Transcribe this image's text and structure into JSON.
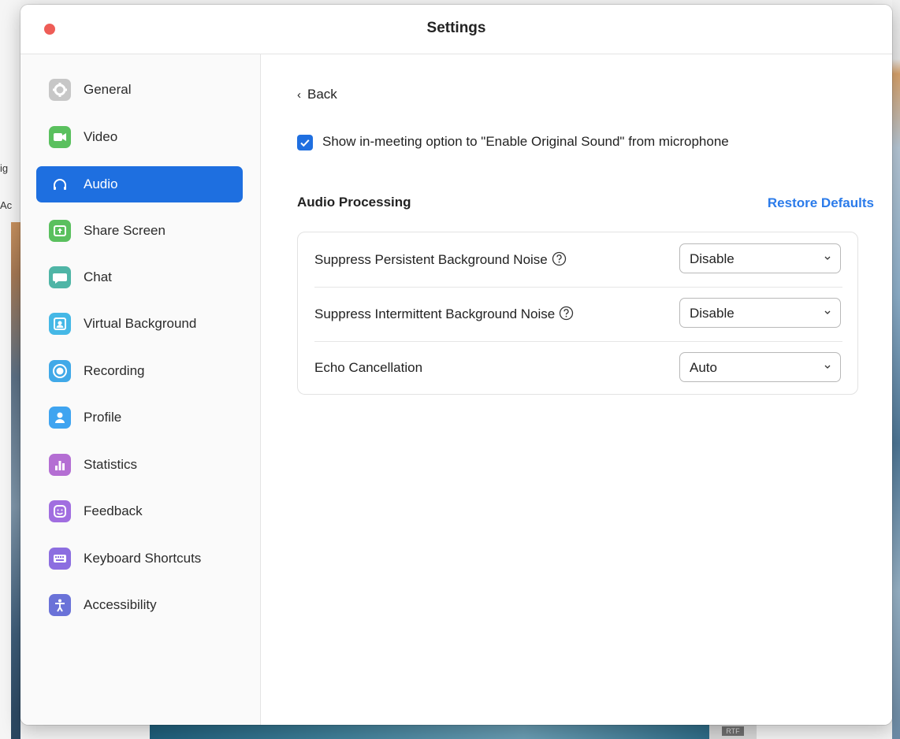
{
  "window": {
    "title": "Settings"
  },
  "background": {
    "frag_left_1": "ig",
    "frag_left_2": "Ac",
    "frag_bottom": "RTF"
  },
  "sidebar": {
    "items": [
      {
        "label": "General",
        "icon": "gear-icon",
        "color": "#c7c7c7"
      },
      {
        "label": "Video",
        "icon": "video-camera-icon",
        "color": "#5ac05e"
      },
      {
        "label": "Audio",
        "icon": "headphones-icon",
        "color": "#1e6fe0",
        "active": true
      },
      {
        "label": "Share Screen",
        "icon": "share-screen-icon",
        "color": "#5ac05e"
      },
      {
        "label": "Chat",
        "icon": "chat-bubble-icon",
        "color": "#4fb5a6"
      },
      {
        "label": "Virtual Background",
        "icon": "person-frame-icon",
        "color": "#45b8e6"
      },
      {
        "label": "Recording",
        "icon": "record-icon",
        "color": "#40a9e8"
      },
      {
        "label": "Profile",
        "icon": "profile-icon",
        "color": "#3fa4f0"
      },
      {
        "label": "Statistics",
        "icon": "bar-chart-icon",
        "color": "#b46ed3"
      },
      {
        "label": "Feedback",
        "icon": "smiley-icon",
        "color": "#a16ee0"
      },
      {
        "label": "Keyboard Shortcuts",
        "icon": "keyboard-icon",
        "color": "#8c6ee0"
      },
      {
        "label": "Accessibility",
        "icon": "accessibility-icon",
        "color": "#6a72d8"
      }
    ]
  },
  "main": {
    "back_label": "Back",
    "original_sound": {
      "label": "Show in-meeting option to \"Enable Original Sound\" from microphone",
      "checked": true
    },
    "section_title": "Audio Processing",
    "restore_label": "Restore Defaults",
    "rows": [
      {
        "label": "Suppress Persistent Background Noise",
        "help": true,
        "value": "Disable"
      },
      {
        "label": "Suppress Intermittent Background Noise",
        "help": true,
        "value": "Disable"
      },
      {
        "label": "Echo Cancellation",
        "help": false,
        "value": "Auto"
      }
    ]
  }
}
